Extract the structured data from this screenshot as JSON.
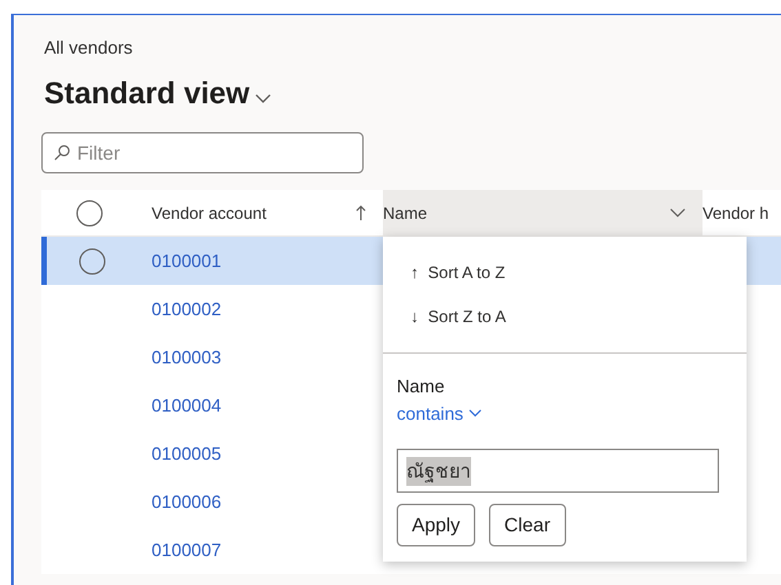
{
  "breadcrumb": "All vendors",
  "view_title": "Standard view",
  "filter": {
    "placeholder": "Filter"
  },
  "table": {
    "columns": [
      {
        "label": "Vendor account",
        "sorted": true
      },
      {
        "label": "Name",
        "sorted": false,
        "menu_open": true
      },
      {
        "label": "Vendor h",
        "sorted": false
      }
    ],
    "rows": [
      {
        "account": "0100001",
        "selected": true
      },
      {
        "account": "0100002",
        "selected": false
      },
      {
        "account": "0100003",
        "selected": false
      },
      {
        "account": "0100004",
        "selected": false
      },
      {
        "account": "0100005",
        "selected": false
      },
      {
        "account": "0100006",
        "selected": false
      },
      {
        "account": "0100007",
        "selected": false
      }
    ]
  },
  "column_menu": {
    "sort_options": [
      {
        "arrow": "↑",
        "label": "Sort A to Z"
      },
      {
        "arrow": "↓",
        "label": "Sort Z to A"
      }
    ],
    "field_label": "Name",
    "operator": "contains",
    "value": "ณัฐชยา",
    "buttons": [
      "Apply",
      "Clear"
    ]
  }
}
